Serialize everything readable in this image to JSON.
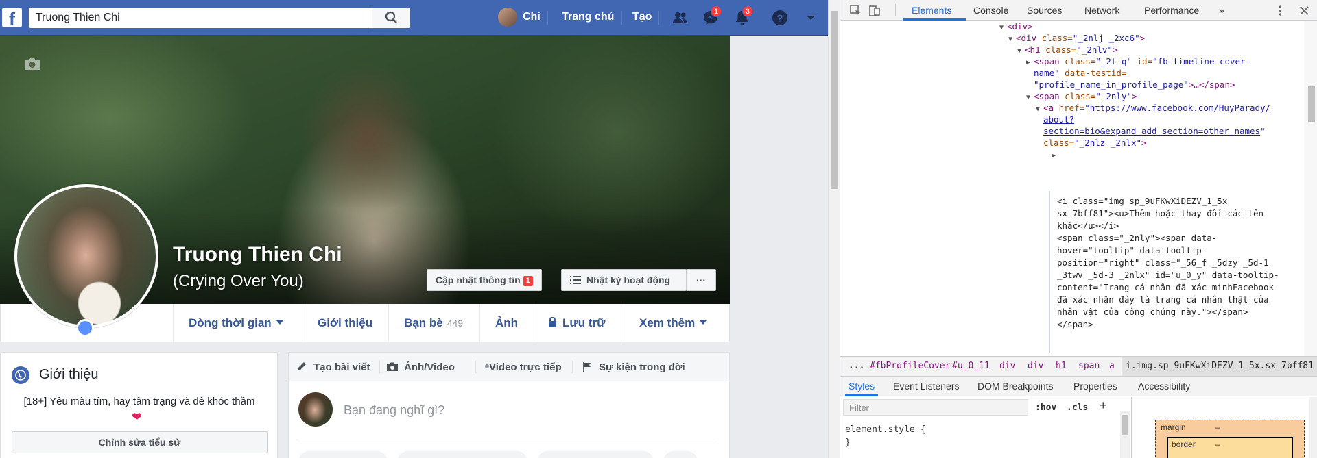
{
  "topbar": {
    "search_value": "Truong Thien Chi",
    "user_name": "Chi",
    "home_label": "Trang chủ",
    "create_label": "Tạo",
    "messenger_badge": "1",
    "notifications_badge": "3",
    "brand_color": "#4267b2"
  },
  "cover": {
    "name": "Truong Thien Chi",
    "alt_name": "(Crying Over You)",
    "update_info_label": "Cập nhật thông tin",
    "update_info_count": "1",
    "activity_log_label": "Nhật ký hoạt động",
    "more_label": "···"
  },
  "tabs": [
    {
      "label": "Dòng thời gian"
    },
    {
      "label": "Giới thiệu"
    },
    {
      "label": "Bạn bè",
      "count": "449"
    },
    {
      "label": "Ảnh"
    },
    {
      "label": "Lưu trữ"
    },
    {
      "label": "Xem thêm"
    }
  ],
  "intro": {
    "title": "Giới thiệu",
    "bio": "[18+] Yêu màu tím, hay tâm trạng và dễ khóc thầm",
    "heart": "❤",
    "edit_label": "Chỉnh sửa tiểu sử"
  },
  "composer": {
    "tabs": [
      "Tạo bài viết",
      "Ảnh/Video",
      "Video trực tiếp",
      "Sự kiện trong đời"
    ],
    "placeholder": "Bạn đang nghĩ gì?"
  },
  "devtools": {
    "tabs": [
      "Elements",
      "Console",
      "Sources",
      "Network",
      "Performance",
      "»"
    ],
    "dom": {
      "l1": "<div>",
      "l2_tag": "<div ",
      "l2_attr": "class=",
      "l2_val": "\"_2nlj _2xc6\"",
      "l3_tag": "<h1 ",
      "l3_attr": "class=",
      "l3_val": "\"_2nlv\"",
      "l4a": "<span ",
      "l4b": "class=",
      "l4c": "\"_2t_q\"",
      "l4d": " id=",
      "l4e": "\"fb-timeline-cover-",
      "l5a": "name\"",
      "l5b": " data-testid=",
      "l6a": "\"profile_name_in_profile_page\"",
      "l6b": ">…</span>",
      "l7a": "<span ",
      "l7b": "class=",
      "l7c": "\"_2nly\"",
      "l7d": ">",
      "l8a": "<a ",
      "l8b": "href=",
      "l8c": "\"",
      "l8d": "https://www.facebook.com/HuyParady/",
      "l9": "about?",
      "l10a": "section=bio&expand_add_section=other_names",
      "l10b": "\"",
      "l11a": "class=",
      "l11b": "\"_2nlz _2nlx\"",
      "l11c": ">",
      "s1": "<i class=\"img sp_9uFKwXiDEZV_1_5x",
      "s2": "sx_7bff81\"><u>Thêm hoặc thay đổi các tên",
      "s3": "khác</u></i>",
      "s4": "<span class=\"_2nly\"><span data-",
      "s5": "hover=\"tooltip\" data-tooltip-",
      "s6": "position=\"right\" class=\"_56_f _5dzy _5d-1",
      "s7": "_3twv _5d-3 _2nlx\" id=\"u_0_y\" data-tooltip-",
      "s8": "content=\"Trang cá nhân đã xác minhFacebook",
      "s9": "đã xác nhận đây là trang cá nhân thật của",
      "s10": "nhân vật của công chúng này.\"></span>",
      "s11": "</span>"
    },
    "breadcrumbs": [
      "...",
      "#fbProfileCover",
      "#u_0_11",
      "div",
      "div",
      "h1",
      "span",
      "a",
      "i.img.sp_9uFKwXiDEZV_1_5x.sx_7bff81"
    ],
    "subtabs": [
      "Styles",
      "Event Listeners",
      "DOM Breakpoints",
      "Properties",
      "Accessibility"
    ],
    "filter_placeholder": "Filter",
    "hov_label": ":hov",
    "cls_label": ".cls",
    "plus_label": "+",
    "element_style_open": "element.style {",
    "element_style_close": "}",
    "box_margin_label": "margin",
    "box_border_label": "border",
    "box_dash": "–"
  }
}
